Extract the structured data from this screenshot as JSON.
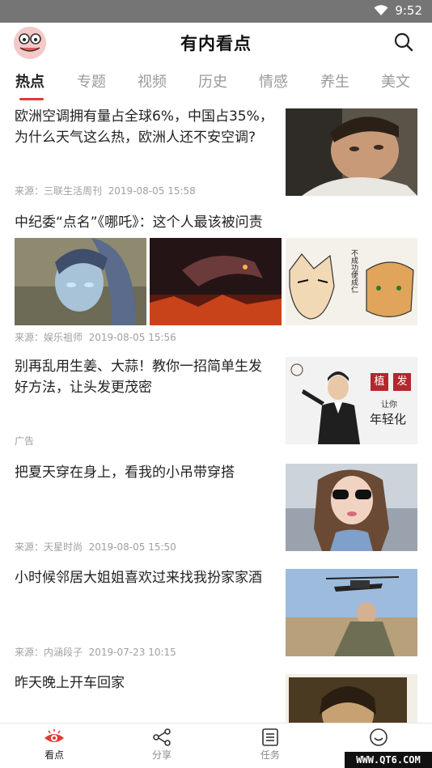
{
  "status_bar": {
    "time": "9:52"
  },
  "app": {
    "title": "有内看点"
  },
  "tabs": [
    {
      "label": "热点",
      "active": true
    },
    {
      "label": "专题"
    },
    {
      "label": "视频"
    },
    {
      "label": "历史"
    },
    {
      "label": "情感"
    },
    {
      "label": "养生"
    },
    {
      "label": "美文"
    }
  ],
  "feed": [
    {
      "headline_line1": "欧洲空调拥有量占全球6%，中国占35%，",
      "headline_line2": "为什么天气这么热，欧洲人还不安空调?",
      "source": "来源：三联生活周刊",
      "time": "2019-08-05 15:58"
    },
    {
      "headline": "中纪委“点名”《哪吒》：这个人最该被问责",
      "source": "来源：娱乐祖师",
      "time": "2019-08-05 15:56",
      "image_text": "不成功便成仁"
    },
    {
      "headline_line1": "别再乱用生姜、大蒜！教你一招简单生发",
      "headline_line2": "好方法，让头发更茂密",
      "source": "广告",
      "time": "",
      "ad_tag1": "植",
      "ad_tag2": "发",
      "ad_line1": "让你",
      "ad_line2": "年轻化"
    },
    {
      "headline": "把夏天穿在身上，看我的小吊带穿搭",
      "source": "来源：天星时尚",
      "time": "2019-08-05 15:50"
    },
    {
      "headline": "小时候邻居大姐姐喜欢过来找我扮家家酒",
      "source": "来源：内涵段子",
      "time": "2019-07-23 10:15"
    },
    {
      "headline": "昨天晚上开车回家"
    }
  ],
  "bottom_nav": [
    {
      "label": "看点",
      "active": true
    },
    {
      "label": "分享"
    },
    {
      "label": "任务"
    },
    {
      "label": ""
    }
  ],
  "watermark": "WWW.QT6.COM",
  "colors": {
    "accent": "#e53935",
    "status_bar": "#757575",
    "meta_text": "#a0a0a0"
  }
}
